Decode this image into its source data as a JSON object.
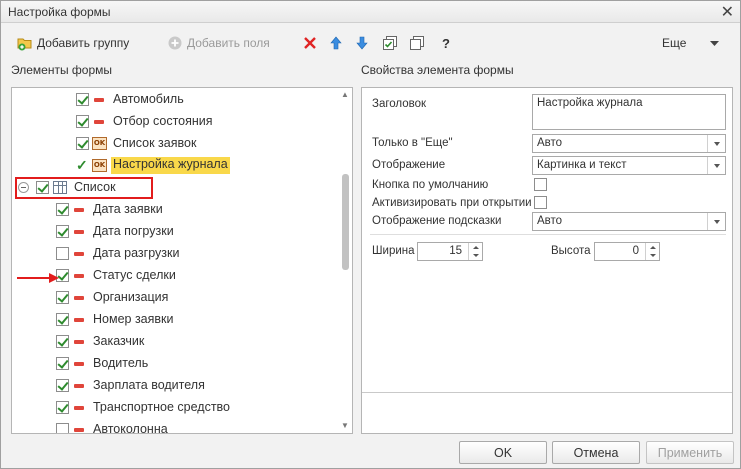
{
  "window": {
    "title": "Настройка формы"
  },
  "toolbar": {
    "add_group": "Добавить группу",
    "add_field": "Добавить поля",
    "help": "?",
    "more": "Еще"
  },
  "left_panel": {
    "title": "Элементы формы",
    "rows": [
      {
        "label": "Автомобиль",
        "checked": true,
        "icon": "minus-icon"
      },
      {
        "label": "Отбор состояния",
        "checked": true,
        "icon": "minus-icon"
      },
      {
        "label": "Список заявок",
        "checked": true,
        "icon": "ok-command-icon"
      },
      {
        "label": "Настройка журнала",
        "checked": true,
        "icon": "ok-command-icon",
        "highlighted": true
      },
      {
        "label": "Список",
        "checked": true,
        "icon": "table-icon",
        "collapsible": true
      },
      {
        "label": "Дата заявки",
        "checked": true,
        "icon": "minus-icon"
      },
      {
        "label": "Дата погрузки",
        "checked": true,
        "icon": "minus-icon"
      },
      {
        "label": "Дата разгрузки",
        "checked": false,
        "icon": "minus-icon"
      },
      {
        "label": "Статус сделки",
        "checked": true,
        "icon": "minus-icon"
      },
      {
        "label": "Организация",
        "checked": true,
        "icon": "minus-icon"
      },
      {
        "label": "Номер заявки",
        "checked": true,
        "icon": "minus-icon"
      },
      {
        "label": "Заказчик",
        "checked": true,
        "icon": "minus-icon"
      },
      {
        "label": "Водитель",
        "checked": true,
        "icon": "minus-icon"
      },
      {
        "label": "Зарплата водителя",
        "checked": true,
        "icon": "minus-icon"
      },
      {
        "label": "Транспортное средство",
        "checked": true,
        "icon": "minus-icon"
      },
      {
        "label": "Автоколонна",
        "checked": false,
        "icon": "minus-icon"
      }
    ]
  },
  "right_panel": {
    "title": "Свойства элемента формы",
    "header_label": "Заголовок",
    "header_value": "Настройка журнала",
    "only_more_label": "Только в \"Еще\"",
    "only_more_value": "Авто",
    "display_label": "Отображение",
    "display_value": "Картинка и текст",
    "default_button_label": "Кнопка по умолчанию",
    "activate_label": "Активизировать при открытии",
    "tooltip_display_label": "Отображение подсказки",
    "tooltip_display_value": "Авто",
    "width_label": "Ширина",
    "width_value": "15",
    "height_label": "Высота",
    "height_value": "0"
  },
  "footer": {
    "ok": "OK",
    "cancel": "Отмена",
    "apply": "Применить"
  }
}
